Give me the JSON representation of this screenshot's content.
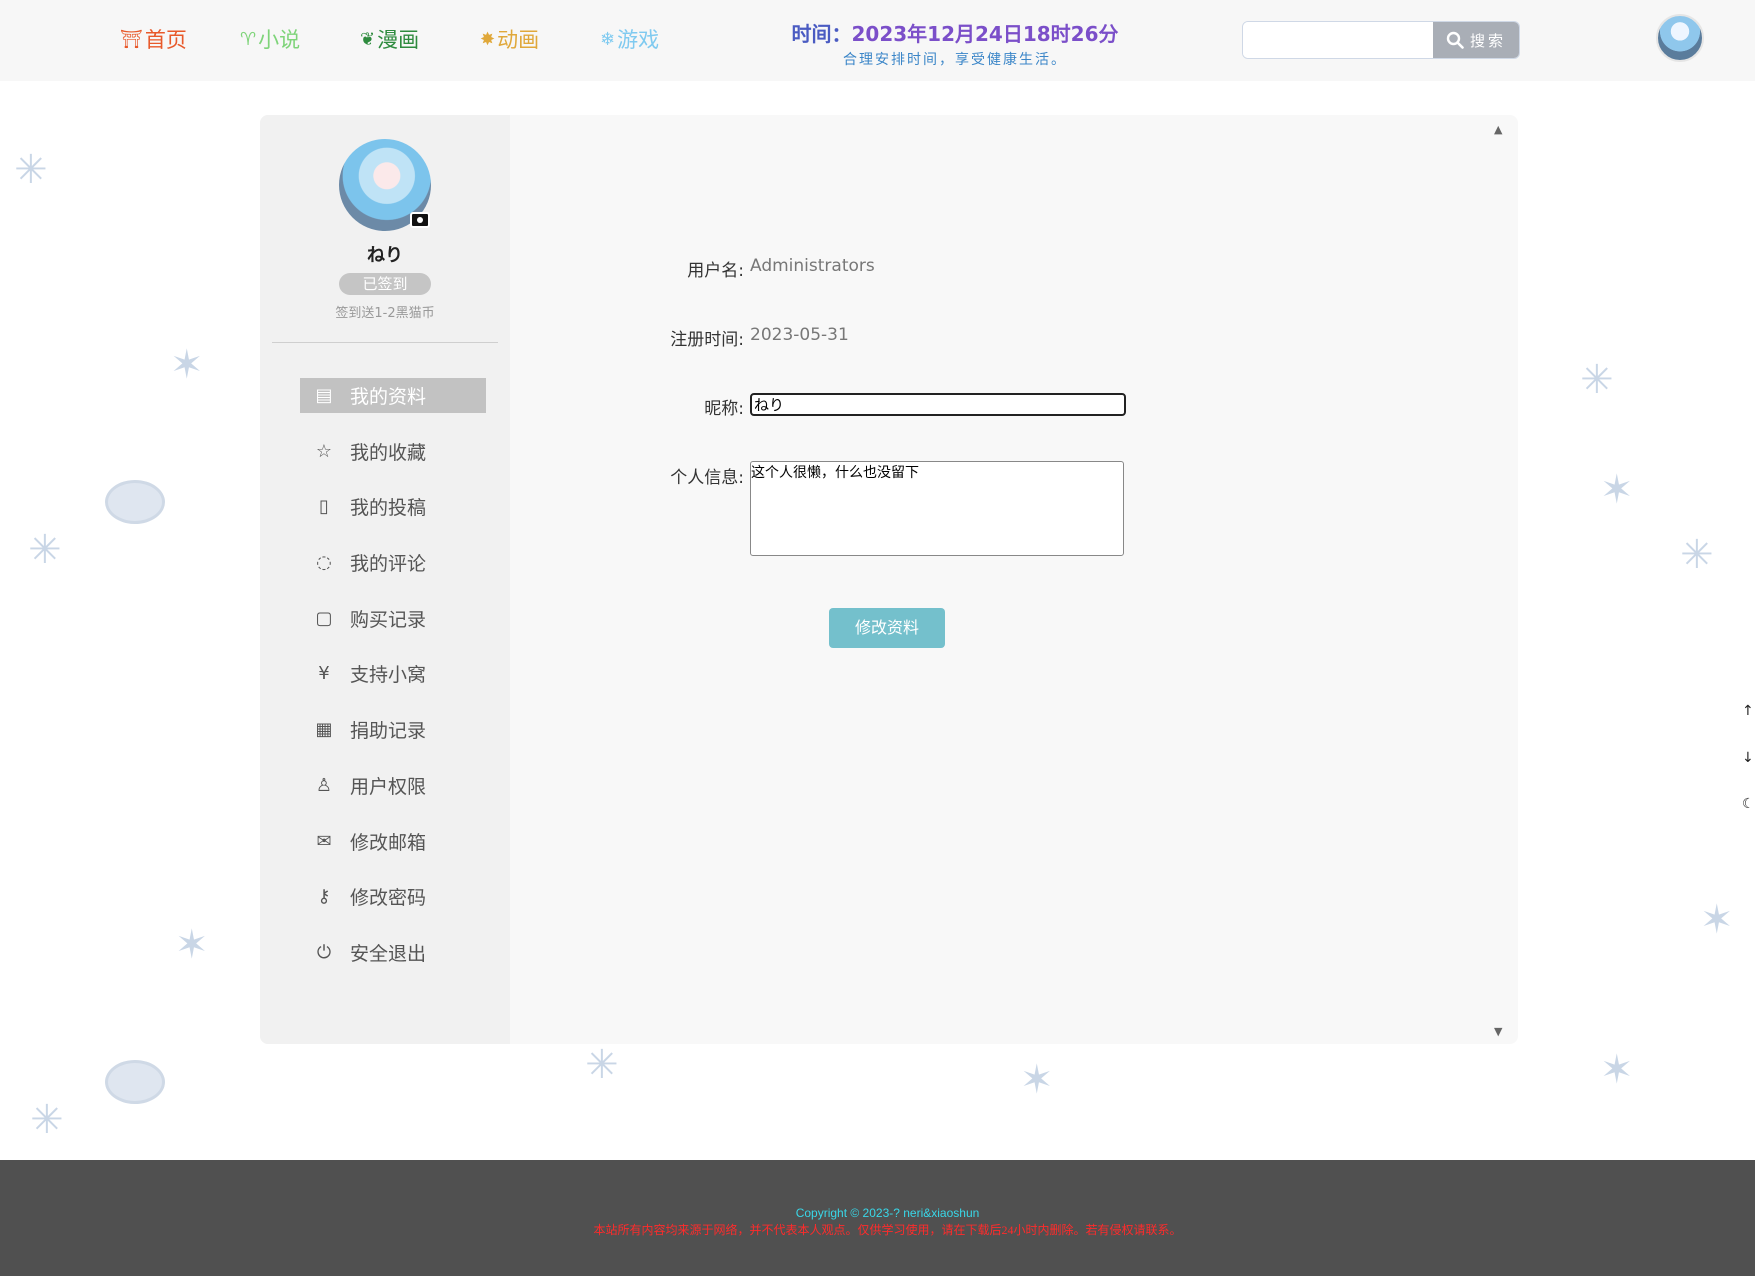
{
  "colors": {
    "accent": "#74c0cc",
    "header_bg": "#f7f7f7",
    "footer_bg": "#505050",
    "copyright": "#39d7e8",
    "disclaimer": "#ff2b2b"
  },
  "nav": {
    "items": [
      {
        "icon": "torii-gate-icon",
        "label": "首页",
        "color": "#e8592a"
      },
      {
        "icon": "sprout-icon",
        "label": "小说",
        "color": "#7fd47a"
      },
      {
        "icon": "leaf-icon",
        "label": "漫画",
        "color": "#2e8b3e"
      },
      {
        "icon": "maple-leaf-icon",
        "label": "动画",
        "color": "#e0a83a"
      },
      {
        "icon": "snowflake-icon",
        "label": "游戏",
        "color": "#7fcaf0"
      }
    ]
  },
  "clock": {
    "prefix": "时间：",
    "value": "2023年12月24日18时26分",
    "tagline": "合理安排时间，享受健康生活。"
  },
  "search": {
    "placeholder": "",
    "button_label": "搜索",
    "icon": "search-icon"
  },
  "profile": {
    "nickname": "ねり",
    "checkin_status": "已签到",
    "checkin_note": "签到送1-2黑猫币"
  },
  "sidebar": {
    "items": [
      {
        "icon": "id-card-icon",
        "label": "我的资料",
        "active": true
      },
      {
        "icon": "star-icon",
        "label": "我的收藏",
        "active": false
      },
      {
        "icon": "document-icon",
        "label": "我的投稿",
        "active": false
      },
      {
        "icon": "comment-icon",
        "label": "我的评论",
        "active": false
      },
      {
        "icon": "clipboard-icon",
        "label": "购买记录",
        "active": false
      },
      {
        "icon": "yen-icon",
        "label": "支持小窝",
        "active": false
      },
      {
        "icon": "newspaper-icon",
        "label": "捐助记录",
        "active": false
      },
      {
        "icon": "user-icon",
        "label": "用户权限",
        "active": false
      },
      {
        "icon": "envelope-icon",
        "label": "修改邮箱",
        "active": false
      },
      {
        "icon": "key-icon",
        "label": "修改密码",
        "active": false
      },
      {
        "icon": "power-icon",
        "label": "安全退出",
        "active": false
      }
    ]
  },
  "form": {
    "username_label": "用户名:",
    "username_value": "Administrators",
    "regdate_label": "注册时间:",
    "regdate_value": "2023-05-31",
    "nickname_label": "昵称:",
    "nickname_value": "ねり",
    "bio_label": "个人信息:",
    "bio_value": "这个人很懒，什么也没留下",
    "submit_label": "修改资料"
  },
  "side_tools": [
    {
      "icon": "arrow-up-icon"
    },
    {
      "icon": "arrow-down-icon"
    },
    {
      "icon": "moon-icon"
    }
  ],
  "footer": {
    "copyright": "Copyright © 2023-?  neri&xiaoshun",
    "disclaimer": "本站所有内容均来源于网络，并不代表本人观点。仅供学习使用，请在下载后24小时内删除。若有侵权请联系。"
  }
}
